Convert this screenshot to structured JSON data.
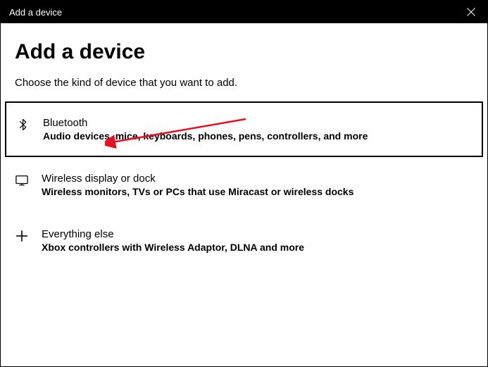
{
  "titlebar": {
    "title": "Add a device"
  },
  "page": {
    "title": "Add a device",
    "subtitle": "Choose the kind of device that you want to add."
  },
  "options": [
    {
      "title": "Bluetooth",
      "description": "Audio devices, mice, keyboards, phones, pens, controllers, and more"
    },
    {
      "title": "Wireless display or dock",
      "description": "Wireless monitors, TVs or PCs that use Miracast or wireless docks"
    },
    {
      "title": "Everything else",
      "description": "Xbox controllers with Wireless Adaptor, DLNA and more"
    }
  ]
}
